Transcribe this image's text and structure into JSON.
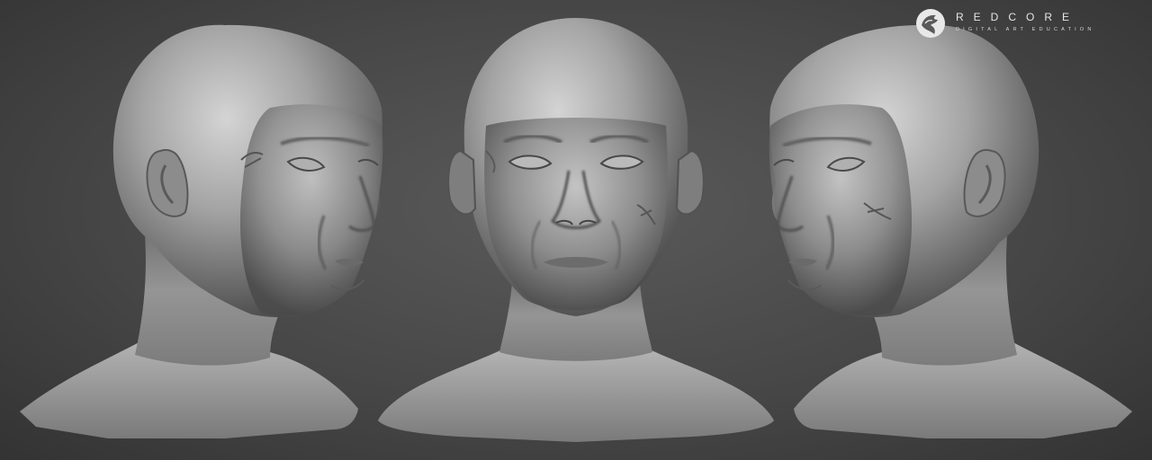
{
  "scene": {
    "subject": "sculpted-head-turnaround",
    "views": [
      "three-quarter-right",
      "front",
      "three-quarter-left"
    ],
    "background_color": "#4a4a4a",
    "clay_color": "#9a9a9a"
  },
  "watermark": {
    "brand": "REDCORE",
    "tagline": "DIGITAL ART EDUCATION",
    "emblem_icon": "dragon-emblem-icon"
  }
}
